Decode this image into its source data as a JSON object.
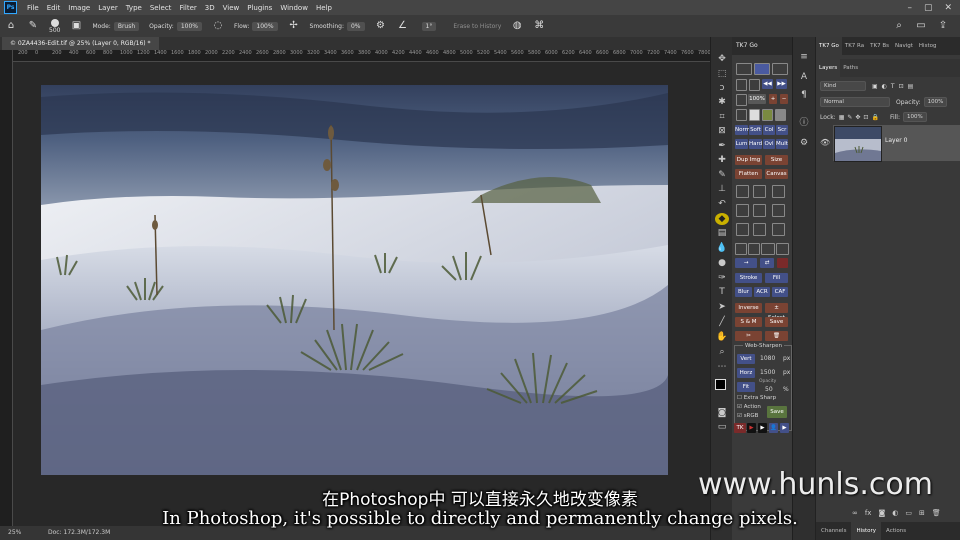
{
  "menubar": {
    "logo": "Ps",
    "items": [
      "File",
      "Edit",
      "Image",
      "Layer",
      "Type",
      "Select",
      "Filter",
      "3D",
      "View",
      "Plugins",
      "Window",
      "Help"
    ]
  },
  "options": {
    "brush_size": "500",
    "mode_label": "Mode:",
    "mode_value": "Brush",
    "opacity_label": "Opacity:",
    "opacity_value": "100%",
    "flow_label": "Flow:",
    "flow_value": "100%",
    "smoothing_label": "Smoothing:",
    "smoothing_value": "0%",
    "angle_value": "1°",
    "erase_history": "Erase to History"
  },
  "document": {
    "tab_title": "© 0ZA4436-Edit.tif @ 25% (Layer 0, RGB/16) *",
    "ruler_ticks": [
      "200",
      "0",
      "200",
      "400",
      "600",
      "800",
      "1000",
      "1200",
      "1400",
      "1600",
      "1800",
      "2000",
      "2200",
      "2400",
      "2600",
      "2800",
      "3000",
      "3200",
      "3400",
      "3600",
      "3800",
      "4000",
      "4200",
      "4400",
      "4600",
      "4800",
      "5000",
      "5200",
      "5400",
      "5600",
      "5800",
      "6000",
      "6200",
      "6400",
      "6600",
      "6800",
      "7000",
      "7200",
      "7400",
      "7600",
      "7800",
      "8000"
    ],
    "zoom": "25%",
    "doc_size": "Doc: 172.3M/172.3M"
  },
  "tk_panel": {
    "tab": "TK7 Go",
    "row_zoom": "100%",
    "blend_row1": [
      "Norm",
      "Soft",
      "Col",
      "Scr"
    ],
    "blend_row2": [
      "Lum",
      "Hard",
      "Ovl",
      "Mult"
    ],
    "dup_img": "Dup Img",
    "size": "Size",
    "flatten": "Flatten",
    "canvas": "Canvas",
    "stroke": "Stroke",
    "fill": "Fill",
    "blur": "Blur",
    "acr": "ACR",
    "caf": "CAF",
    "inverse": "Inverse",
    "sselect": "± Select",
    "sm": "S & M",
    "save": "Save",
    "web_sharpen": "Web-Sharpen",
    "vert": "Vert",
    "vert_value": "1080",
    "horz": "Horz",
    "horz_value": "1500",
    "px": "px",
    "fit": "Fit",
    "opacity_label": "Opacity",
    "opacity_value": "50",
    "pct": "%",
    "extra_sharp": "Extra Sharp",
    "action": "Action",
    "srgb": "sRGB",
    "save2": "Save",
    "tk": "TK"
  },
  "layers_panel": {
    "tabs": [
      "TK7 Go",
      "TK7 Ra",
      "TK7 Bs",
      "Navigt",
      "Histog"
    ],
    "sub_tabs": [
      "Layers",
      "Paths"
    ],
    "kind": "Kind",
    "blend_mode": "Normal",
    "opacity_label": "Opacity:",
    "opacity_value": "100%",
    "lock_label": "Lock:",
    "fill_label": "Fill:",
    "fill_value": "100%",
    "layer_name": "Layer 0",
    "bottom_tabs": [
      "Channels",
      "History",
      "Actions"
    ]
  },
  "captions": {
    "chinese": "在Photoshop中 可以直接永久地改变像素",
    "english": "In Photoshop, it's possible to directly and permanently change pixels.",
    "watermark": "www.hunls.com"
  }
}
